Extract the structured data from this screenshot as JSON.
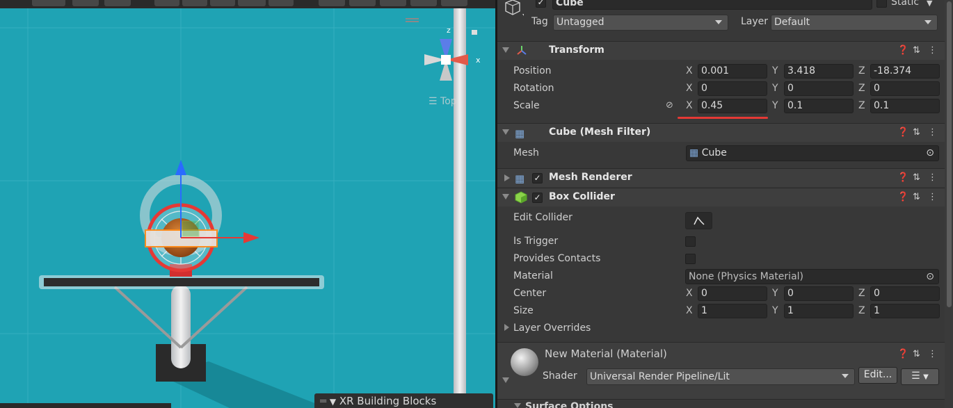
{
  "scene": {
    "orientation_label": "Top",
    "gizmo_y_label": "z",
    "gizmo_x_label": "x",
    "bottom_panel_label": "XR Building Blocks"
  },
  "header": {
    "object_name": "Cube",
    "static_label": "Static",
    "tag_label": "Tag",
    "tag_value": "Untagged",
    "layer_label": "Layer",
    "layer_value": "Default"
  },
  "transform": {
    "title": "Transform",
    "position_label": "Position",
    "rotation_label": "Rotation",
    "scale_label": "Scale",
    "position": {
      "x": "0.001",
      "y": "3.418",
      "z": "-18.374"
    },
    "rotation": {
      "x": "0",
      "y": "0",
      "z": "0"
    },
    "scale": {
      "x": "0.45",
      "y": "0.1",
      "z": "0.1"
    },
    "axis_x": "X",
    "axis_y": "Y",
    "axis_z": "Z"
  },
  "mesh_filter": {
    "title": "Cube (Mesh Filter)",
    "mesh_label": "Mesh",
    "mesh_value": "Cube"
  },
  "mesh_renderer": {
    "title": "Mesh Renderer"
  },
  "box_collider": {
    "title": "Box Collider",
    "edit_collider_label": "Edit Collider",
    "is_trigger_label": "Is Trigger",
    "provides_contacts_label": "Provides Contacts",
    "material_label": "Material",
    "material_value": "None (Physics Material)",
    "center_label": "Center",
    "center": {
      "x": "0",
      "y": "0",
      "z": "0"
    },
    "size_label": "Size",
    "size": {
      "x": "1",
      "y": "1",
      "z": "1"
    },
    "layer_overrides_label": "Layer Overrides"
  },
  "material": {
    "title": "New Material (Material)",
    "shader_label": "Shader",
    "shader_value": "Universal Render Pipeline/Lit",
    "edit_button": "Edit...",
    "surface_options_label": "Surface Options"
  },
  "colors": {
    "scene_bg": "#1fa3b4",
    "inspector_bg": "#383838",
    "highlight_underline": "#e53935",
    "selection_outline": "#ff8c1a"
  }
}
